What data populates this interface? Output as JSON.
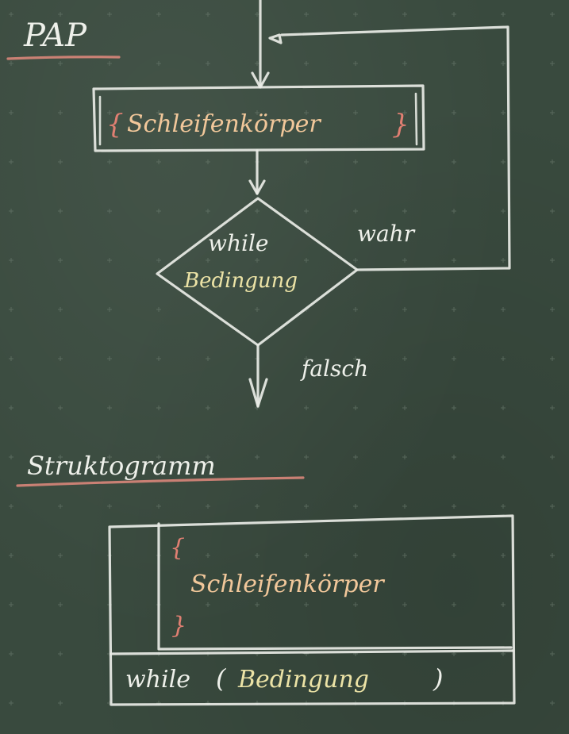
{
  "pap": {
    "heading": "PAP",
    "body_open": "{",
    "body_label": "Schleifenkörper",
    "body_close": "}",
    "condition_keyword": "while",
    "condition_label": "Bedingung",
    "true_label": "wahr",
    "false_label": "falsch"
  },
  "struktogramm": {
    "heading": "Struktogramm",
    "body_open": "{",
    "body_label": "Schleifenkörper",
    "body_close": "}",
    "footer_keyword": "while",
    "footer_paren_open": "(",
    "footer_condition": "Bedingung",
    "footer_paren_close": ")"
  },
  "colors": {
    "board": "#394a3e",
    "chalk_white": "#e9ece6",
    "chalk_red": "#d9867a",
    "chalk_yellow": "#ece3a6",
    "chalk_orange": "#f1c79a"
  }
}
